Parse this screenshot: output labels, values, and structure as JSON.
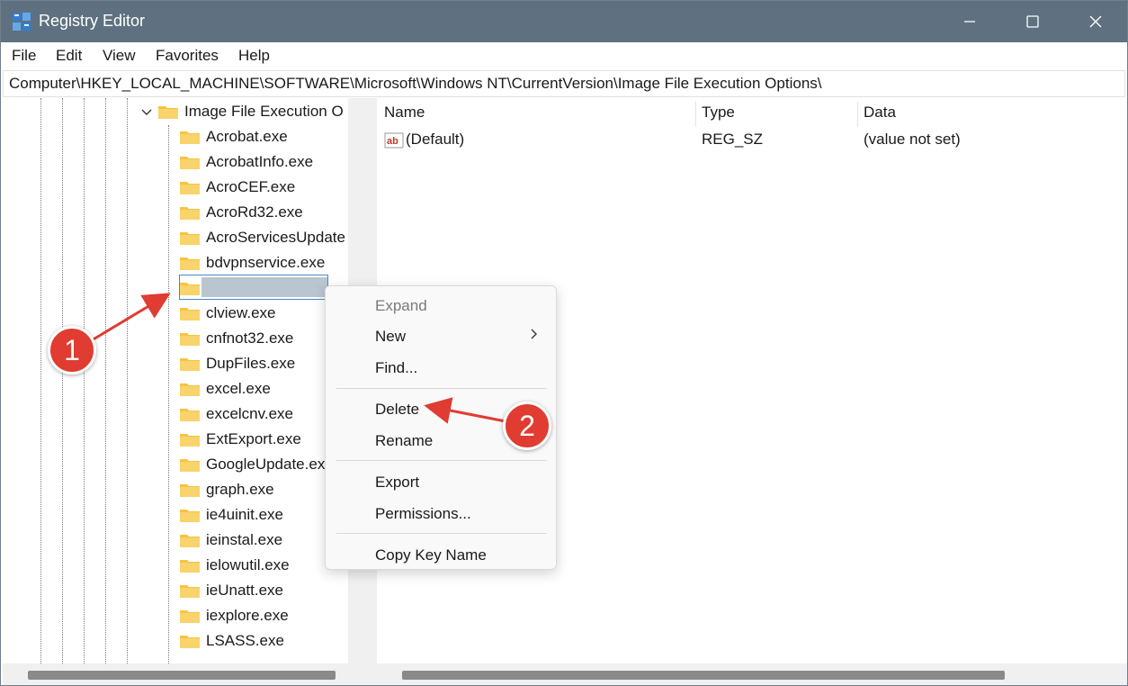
{
  "window": {
    "title": "Registry Editor",
    "icon": "registry-icon",
    "controls": [
      "minimize-icon",
      "maximize-icon",
      "close-icon"
    ]
  },
  "menu": {
    "file": "File",
    "edit": "Edit",
    "view": "View",
    "favorites": "Favorites",
    "help": "Help"
  },
  "address": {
    "path": "Computer\\HKEY_LOCAL_MACHINE\\SOFTWARE\\Microsoft\\Windows NT\\CurrentVersion\\Image File Execution Options\\"
  },
  "tree": {
    "parent_key": "Image File Execution O",
    "children": [
      "Acrobat.exe",
      "AcrobatInfo.exe",
      "AcroCEF.exe",
      "AcroRd32.exe",
      "AcroServicesUpdate",
      "bdvpnservice.exe",
      "",
      "clview.exe",
      "cnfnot32.exe",
      "DupFiles.exe",
      "excel.exe",
      "excelcnv.exe",
      "ExtExport.exe",
      "GoogleUpdate.ex",
      "graph.exe",
      "ie4uinit.exe",
      "ieinstal.exe",
      "ielowutil.exe",
      "ieUnatt.exe",
      "iexplore.exe",
      "LSASS.exe"
    ]
  },
  "values": {
    "columns": {
      "name": "Name",
      "type": "Type",
      "data": "Data"
    },
    "rows": [
      {
        "name": "(Default)",
        "type": "REG_SZ",
        "data": "(value not set)"
      }
    ]
  },
  "context_menu": {
    "expand": "Expand",
    "new": "New",
    "find": "Find...",
    "delete": "Delete",
    "rename": "Rename",
    "export": "Export",
    "permissions": "Permissions...",
    "copy_key_name": "Copy Key Name"
  },
  "annotations": {
    "step1": "1",
    "step2": "2",
    "color": "#e03c31"
  },
  "colors": {
    "titlebar": "#5f7180",
    "folder": "#f6c343",
    "selection_border": "#4e86c8"
  }
}
